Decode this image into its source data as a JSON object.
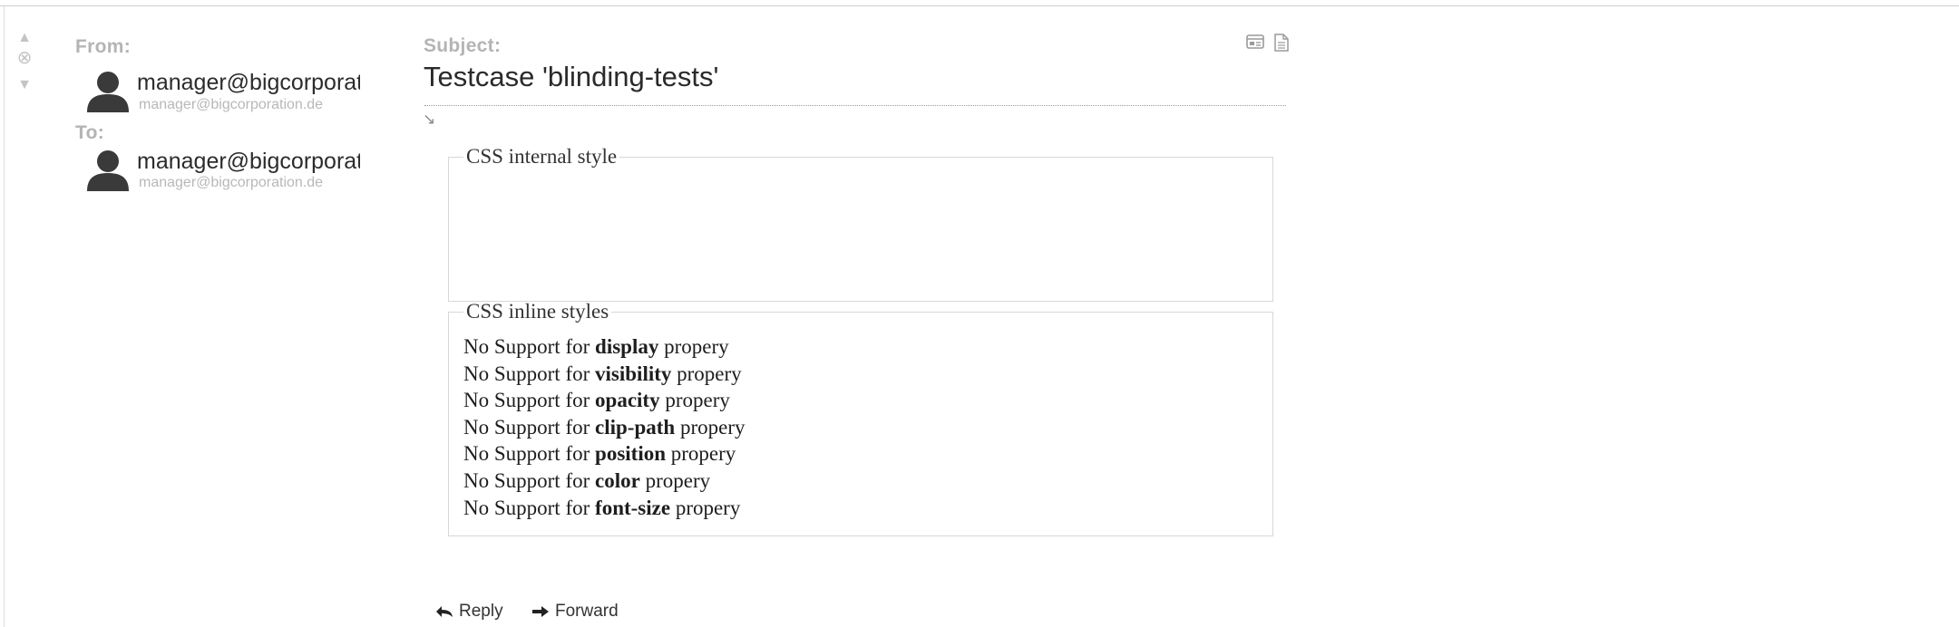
{
  "nav": {
    "up_icon": "arrow-up-icon",
    "close_icon": "close-circle-icon",
    "down_icon": "arrow-down-icon"
  },
  "header": {
    "from_label": "From:",
    "to_label": "To:",
    "subject_label": "Subject:",
    "from": {
      "name": "manager@bigcorporation.de",
      "email": "manager@bigcorporation.de"
    },
    "to": {
      "name": "manager@bigcorporation.de",
      "email": "manager@bigcorporation.de"
    },
    "subject": "Testcase 'blinding-tests'",
    "expand_icon": "expand-arrow-icon",
    "view_icons": [
      "headers-icon",
      "raw-source-icon"
    ]
  },
  "body": {
    "internal": {
      "legend": "CSS internal style"
    },
    "inline": {
      "legend": "CSS inline styles",
      "lines": [
        {
          "prefix": "No Support for ",
          "property": "display",
          "suffix": " propery"
        },
        {
          "prefix": "No Support for ",
          "property": "visibility",
          "suffix": " propery"
        },
        {
          "prefix": "No Support for ",
          "property": "opacity",
          "suffix": " propery"
        },
        {
          "prefix": "No Support for ",
          "property": "clip-path",
          "suffix": " propery"
        },
        {
          "prefix": "No Support for ",
          "property": "position",
          "suffix": " propery"
        },
        {
          "prefix": "No Support for ",
          "property": "color",
          "suffix": " propery"
        },
        {
          "prefix": "No Support for ",
          "property": "font-size",
          "suffix": " propery"
        }
      ]
    }
  },
  "actions": {
    "reply_label": "Reply",
    "forward_label": "Forward"
  }
}
